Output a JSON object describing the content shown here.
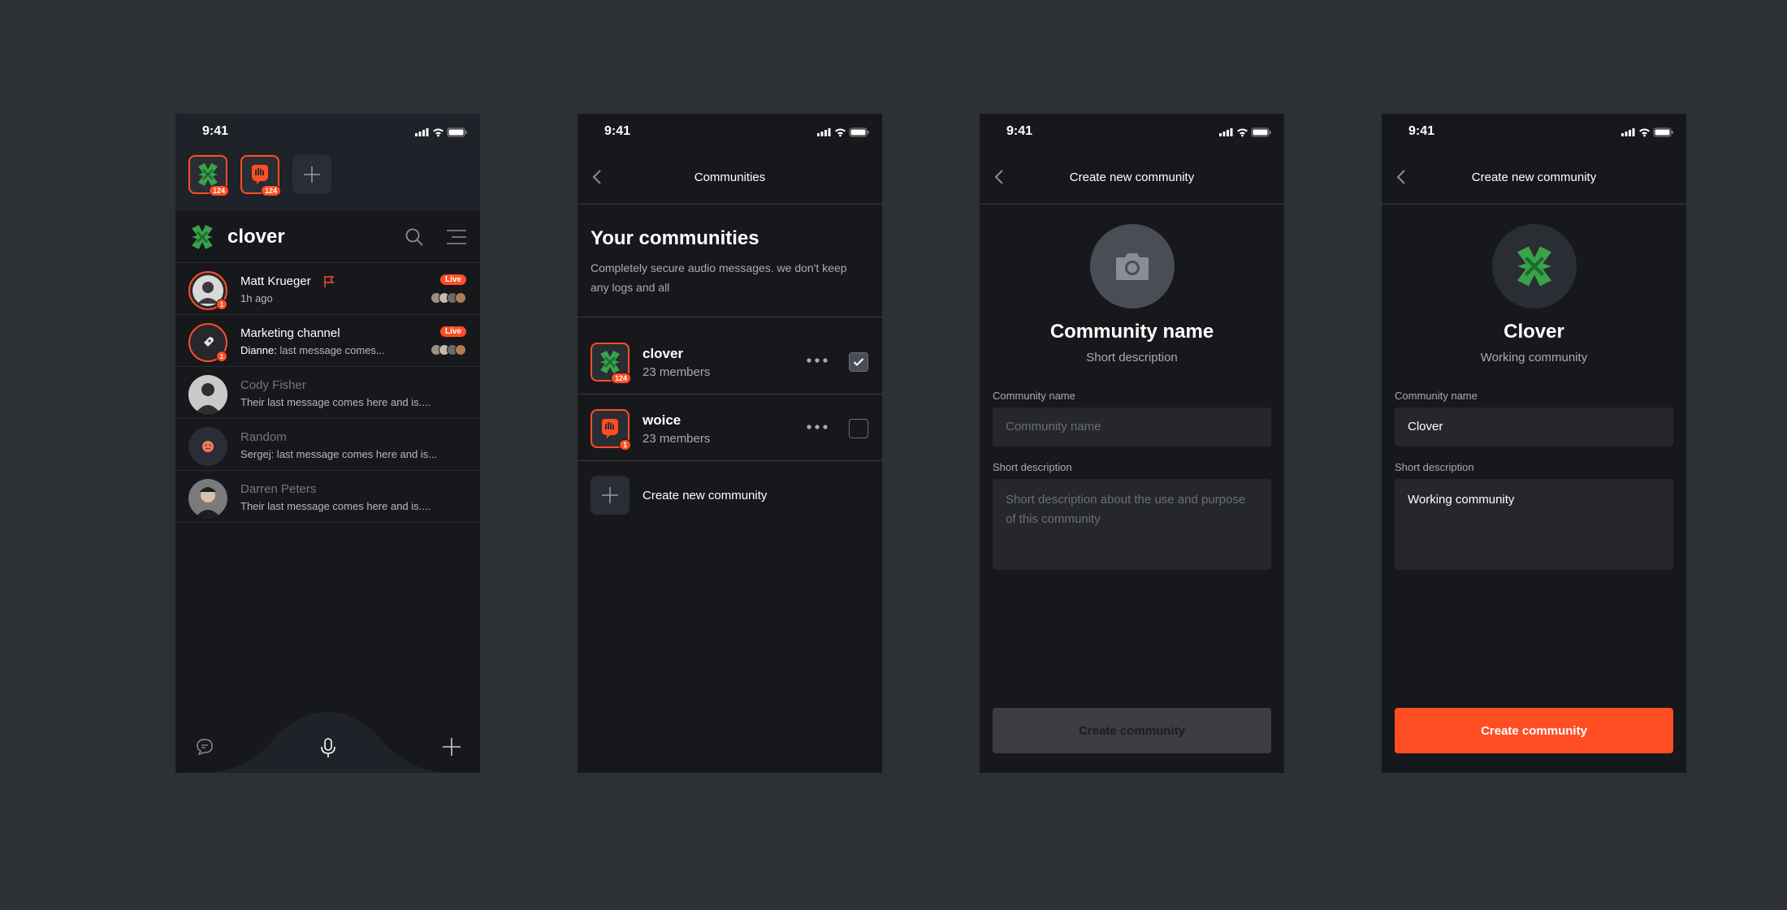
{
  "status": {
    "time": "9:41"
  },
  "home": {
    "community_badges": [
      "124",
      "124"
    ],
    "app_name": "clover",
    "chats": [
      {
        "name": "Matt Krueger",
        "sub": "1h ago",
        "live": "Live",
        "count": "1"
      },
      {
        "name": "Marketing channel",
        "sender": "Dianne:",
        "sub": "last message comes...",
        "live": "Live",
        "count": "1"
      },
      {
        "name": "Cody Fisher",
        "sub": "Their last message comes here and is...."
      },
      {
        "name": "Random",
        "sub": "Sergej: last message comes here and is..."
      },
      {
        "name": "Darren Peters",
        "sub": "Their last message comes here and is...."
      }
    ]
  },
  "communities": {
    "nav_title": "Communities",
    "heading": "Your communities",
    "description": "Completely secure audio messages. we don't keep any logs and all",
    "items": [
      {
        "name": "clover",
        "members": "23 members",
        "badge": "124",
        "selected": true
      },
      {
        "name": "woice",
        "members": "23 members",
        "badge": "1",
        "selected": false
      }
    ],
    "create_label": "Create new community"
  },
  "create_empty": {
    "nav_title": "Create new community",
    "title": "Community name",
    "subtitle": "Short description",
    "name_label": "Community name",
    "name_placeholder": "Community name",
    "desc_label": "Short description",
    "desc_placeholder": "Short description about the use and purpose of this community",
    "cta": "Create community"
  },
  "create_filled": {
    "nav_title": "Create new community",
    "title": "Clover",
    "subtitle": "Working community",
    "name_label": "Community name",
    "name_value": "Clover",
    "desc_label": "Short description",
    "desc_value": "Working community",
    "cta": "Create community"
  },
  "colors": {
    "accent": "#ff4e24",
    "background": "#17181b",
    "page": "#2d3035",
    "clover_green": "#3aa34a"
  }
}
